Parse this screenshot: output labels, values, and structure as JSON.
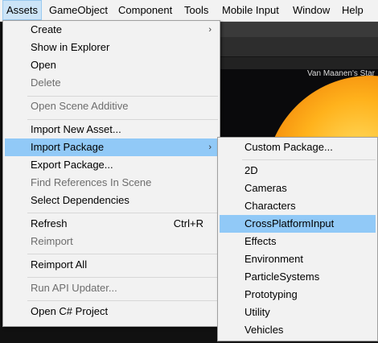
{
  "menubar": {
    "items": [
      "Assets",
      "GameObject",
      "Component",
      "Tools",
      "Mobile Input",
      "Window",
      "Help"
    ]
  },
  "scene": {
    "label": "Van Maanen's Star"
  },
  "assets_menu": {
    "items": [
      {
        "label": "Create",
        "submenu": true
      },
      {
        "label": "Show in Explorer"
      },
      {
        "label": "Open"
      },
      {
        "label": "Delete",
        "disabled": true
      },
      {
        "label": "Open Scene Additive",
        "disabled": true
      },
      {
        "label": "Import New Asset..."
      },
      {
        "label": "Import Package",
        "submenu": true,
        "highlighted": true
      },
      {
        "label": "Export Package..."
      },
      {
        "label": "Find References In Scene",
        "disabled": true
      },
      {
        "label": "Select Dependencies"
      },
      {
        "label": "Refresh",
        "shortcut": "Ctrl+R"
      },
      {
        "label": "Reimport",
        "disabled": true
      },
      {
        "label": "Reimport All"
      },
      {
        "label": "Run API Updater...",
        "disabled": true
      },
      {
        "label": "Open C# Project"
      }
    ]
  },
  "import_submenu": {
    "items": [
      {
        "label": "Custom Package..."
      },
      {
        "label": "2D"
      },
      {
        "label": "Cameras"
      },
      {
        "label": "Characters"
      },
      {
        "label": "CrossPlatformInput",
        "highlighted": true
      },
      {
        "label": "Effects"
      },
      {
        "label": "Environment"
      },
      {
        "label": "ParticleSystems"
      },
      {
        "label": "Prototyping"
      },
      {
        "label": "Utility"
      },
      {
        "label": "Vehicles"
      }
    ]
  },
  "colors": {
    "menu_bg": "#f2f2f2",
    "highlight": "#91c9f7",
    "menubar_active": "#cce4f7",
    "disabled_text": "#6d6d6d"
  }
}
